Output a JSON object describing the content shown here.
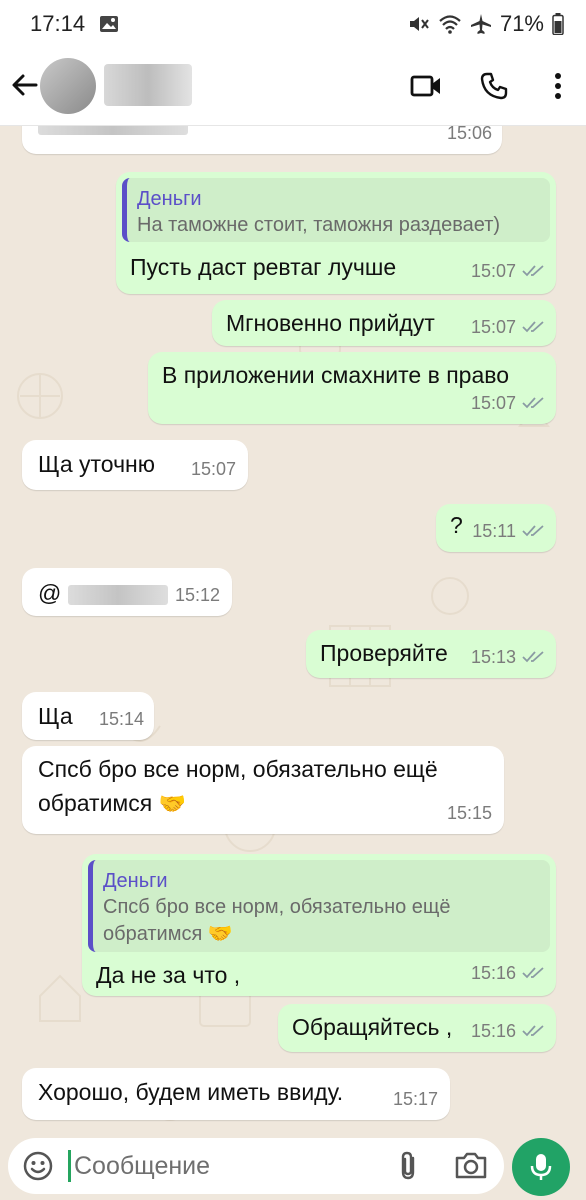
{
  "status_bar": {
    "time": "17:14",
    "battery": "71%",
    "icons": [
      "image-icon",
      "mute-icon",
      "wifi-icon",
      "airplane-icon",
      "battery-icon"
    ]
  },
  "app_bar": {
    "icons": [
      "back-arrow-icon",
      "video-call-icon",
      "phone-icon",
      "more-vert-icon"
    ]
  },
  "messages": [
    {
      "dir": "in",
      "text": "",
      "time": "15:06"
    },
    {
      "dir": "out",
      "quote_author": "Деньги",
      "quote_text": "На таможне стоит, таможня раздевает)",
      "text": "Пусть даст ревтаг лучше",
      "time": "15:07"
    },
    {
      "dir": "out",
      "text": "Мгновенно прийдут",
      "time": "15:07"
    },
    {
      "dir": "out",
      "text": "В приложении смахните в право",
      "time": "15:07"
    },
    {
      "dir": "in",
      "text": "Ща уточню",
      "time": "15:07"
    },
    {
      "dir": "out",
      "text": "?",
      "time": "15:11"
    },
    {
      "dir": "in",
      "text": "@",
      "time": "15:12"
    },
    {
      "dir": "out",
      "text": "Проверяйте",
      "time": "15:13"
    },
    {
      "dir": "in",
      "text": "Ща",
      "time": "15:14"
    },
    {
      "dir": "in",
      "text_line1": "Спсб бро все норм, обязательно ещё",
      "text_line2": "обратимся",
      "emoji": "🤝",
      "time": "15:15"
    },
    {
      "dir": "out",
      "quote_author": "Деньги",
      "quote_line1": "Спсб бро все норм, обязательно ещё",
      "quote_line2": "обратимся",
      "quote_emoji": "🤝",
      "text": "Да не за что ,",
      "time": "15:16"
    },
    {
      "dir": "out",
      "text": "Обращяйтесь ,",
      "time": "15:16"
    },
    {
      "dir": "in",
      "text": "Хорошо, будем иметь ввиду.",
      "time": "15:17"
    }
  ],
  "input": {
    "placeholder": "Сообщение"
  },
  "colors": {
    "outgoing": "#d9fdd3",
    "incoming": "#ffffff",
    "accent": "#21a366",
    "quote_accent": "#5b4fc8",
    "read_ticks": "#8a9aa3"
  }
}
